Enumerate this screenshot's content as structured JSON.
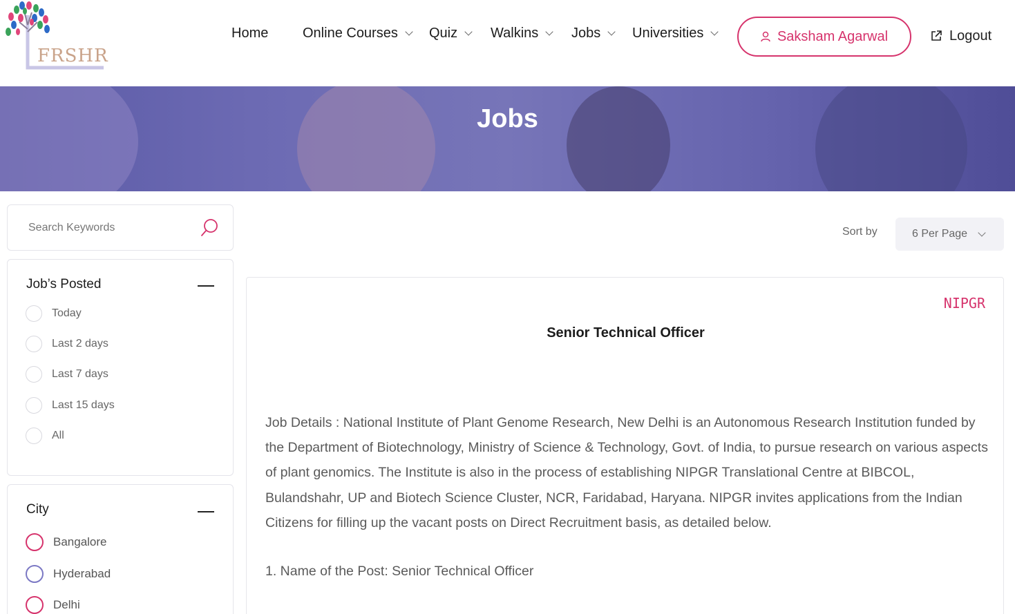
{
  "header": {
    "logo_text": "FRSHR",
    "nav": [
      {
        "label": "Home",
        "has_dropdown": false
      },
      {
        "label": "Online Courses",
        "has_dropdown": true
      },
      {
        "label": "Quiz",
        "has_dropdown": true
      },
      {
        "label": "Walkins",
        "has_dropdown": true
      },
      {
        "label": "Jobs",
        "has_dropdown": true
      },
      {
        "label": "Universities",
        "has_dropdown": true
      }
    ],
    "user_name": "Saksham Agarwal",
    "logout_label": "Logout"
  },
  "hero": {
    "title": "Jobs"
  },
  "sidebar": {
    "search": {
      "placeholder": "Search Keywords"
    },
    "jobs_posted": {
      "title": "Job’s Posted",
      "options": [
        "Today",
        "Last 2 days",
        "Last 7 days",
        "Last 15 days",
        "All"
      ]
    },
    "city": {
      "title": "City",
      "options": [
        {
          "label": "Bangalore",
          "color": "#d6336c"
        },
        {
          "label": "Hyderabad",
          "color": "#7b78c4"
        },
        {
          "label": "Delhi",
          "color": "#d6336c"
        }
      ]
    }
  },
  "main": {
    "sort_label": "Sort by",
    "sort_value": "6 Per Page",
    "job": {
      "org": "NIPGR",
      "title": "Senior Technical Officer",
      "description": "Job Details : National Institute of Plant Genome Research, New Delhi is an Autonomous Research Institution funded by the Department of Biotechnology, Ministry of Science & Technology, Govt. of India, to pursue research on various aspects of plant genomics. The Institute is also in the process of establishing NIPGR Translational Centre at BIBCOL, Bulandshahr, UP and Biotech Science Cluster, NCR, Faridabad, Haryana. NIPGR invites applications from the Indian Citizens for filling up the vacant posts on Direct Recruitment basis, as detailed below.",
      "post_line": "1. Name of the Post: Senior Technical Officer"
    }
  },
  "colors": {
    "accent": "#d6336c",
    "hero": "#6c6ab3"
  }
}
